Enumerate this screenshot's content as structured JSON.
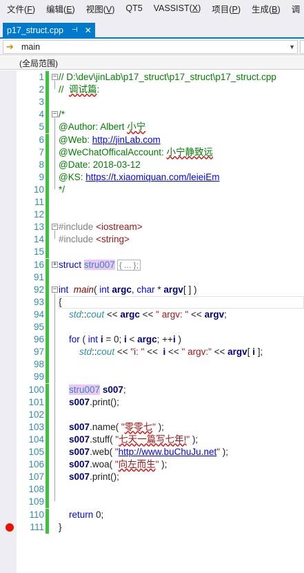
{
  "menu": [
    {
      "label": "文件",
      "key": "F"
    },
    {
      "label": "编辑",
      "key": "E"
    },
    {
      "label": "视图",
      "key": "V"
    },
    {
      "label": "QT5",
      "key": ""
    },
    {
      "label": "VASSIST",
      "key": "X"
    },
    {
      "label": "项目",
      "key": "P"
    },
    {
      "label": "生成",
      "key": "B"
    },
    {
      "label": "调",
      "key": ""
    }
  ],
  "tab": {
    "title": "p17_struct.cpp",
    "pin": "⊣",
    "close": "✕"
  },
  "navbar": {
    "function": "main",
    "scope": "(全局范围)"
  },
  "editor": {
    "lines": [
      {
        "n": "1",
        "html": "<span class=\"c-com\">// D:\\dev\\jinLab\\p17_struct\\p17_struct\\p17_struct.cpp</span>"
      },
      {
        "n": "2",
        "html": "<span class=\"c-com\">//  <span class=\"squig\">调试篇</span>:</span>"
      },
      {
        "n": "3",
        "html": ""
      },
      {
        "n": "4",
        "html": "<span class=\"c-com\">/*</span>"
      },
      {
        "n": "5",
        "html": "<span class=\"c-com\">@Author: Albert <span class=\"squig\">小宁</span></span>"
      },
      {
        "n": "6",
        "html": "<span class=\"c-com\">@Web: <span class=\"link\">http://jinLab.com</span></span>"
      },
      {
        "n": "7",
        "html": "<span class=\"c-com\">@WeChatOfficalAccount: <span class=\"squig\">小宁静致远</span></span>"
      },
      {
        "n": "8",
        "html": "<span class=\"c-com\">@Date: 2018-03-12</span>"
      },
      {
        "n": "9",
        "html": "<span class=\"c-com\">@KS: <span class=\"link\">https://t.xiaomiquan.com/leieiEm</span></span>"
      },
      {
        "n": "10",
        "html": "<span class=\"c-com\">*/</span>"
      },
      {
        "n": "11",
        "html": ""
      },
      {
        "n": "12",
        "html": ""
      },
      {
        "n": "13",
        "html": "<span class=\"c-pp\">#include</span> <span class=\"c-str\">&lt;iostream&gt;</span>"
      },
      {
        "n": "14",
        "html": "<span class=\"c-pp\">#include</span> <span class=\"c-str\">&lt;string&gt;</span>"
      },
      {
        "n": "15",
        "html": ""
      },
      {
        "n": "16",
        "html": "<span class=\"c-kw\">struct</span> <span class=\"c-type hl\">stru007</span><span class=\"collapsed\">{ ... };</span>"
      },
      {
        "n": "91",
        "html": ""
      },
      {
        "n": "92",
        "html": "<span class=\"c-kw\">int</span>  <span class=\"c-fn\">main</span>( <span class=\"c-kw\">int</span> <span class=\"c-var\">argc</span>, <span class=\"c-kw\">char</span> * <span class=\"c-var\">argv</span>[ ] )"
      },
      {
        "n": "93",
        "html": "{"
      },
      {
        "n": "94",
        "html": "    <span class=\"c-ns\">std</span>::<span class=\"c-ns\">cout</span> &lt;&lt; <span class=\"c-var\">argc</span> &lt;&lt; <span class=\"c-str\">\" argv: \"</span> &lt;&lt; <span class=\"c-var\">argv</span>;"
      },
      {
        "n": "95",
        "html": ""
      },
      {
        "n": "96",
        "html": "    <span class=\"c-kw\">for</span> ( <span class=\"c-kw\">int</span> <span class=\"c-var\">i</span> = 0; <span class=\"c-var\">i</span> &lt; <span class=\"c-var\">argc</span>; ++<span class=\"c-var\">i</span> )"
      },
      {
        "n": "97",
        "html": "        <span class=\"c-ns\">std</span>::<span class=\"c-ns\">cout</span> &lt;&lt; <span class=\"c-str\">\"i: \"</span> &lt;&lt;  <span class=\"c-var\">i</span> &lt;&lt; <span class=\"c-str\">\" argv:\"</span> &lt;&lt; <span class=\"c-var\">argv</span>[ <span class=\"c-var\">i</span> ];"
      },
      {
        "n": "98",
        "html": ""
      },
      {
        "n": "99",
        "html": ""
      },
      {
        "n": "100",
        "html": "    <span class=\"c-type hl\">stru007</span> <span class=\"c-var\">s007</span>;"
      },
      {
        "n": "101",
        "html": "    <span class=\"c-var\">s007</span>.print();"
      },
      {
        "n": "102",
        "html": ""
      },
      {
        "n": "103",
        "html": "    <span class=\"c-var\">s007</span>.name( <span class=\"c-str\">\"<span class=\"squig\">零零七</span>\"</span> );"
      },
      {
        "n": "104",
        "html": "    <span class=\"c-var\">s007</span>.stuff( <span class=\"c-str\">\"<span class=\"squig\">七天一篇写七年!</span>\"</span> );"
      },
      {
        "n": "105",
        "html": "    <span class=\"c-var\">s007</span>.web( <span class=\"c-str\">\"<span class=\"link\">http://www.buChuJu.net</span>\"</span> );"
      },
      {
        "n": "106",
        "html": "    <span class=\"c-var\">s007</span>.woa( <span class=\"c-str\">\"<span class=\"squig\">向左而生</span>\"</span> );"
      },
      {
        "n": "107",
        "html": "    <span class=\"c-var\">s007</span>.print();"
      },
      {
        "n": "108",
        "html": ""
      },
      {
        "n": "109",
        "html": ""
      },
      {
        "n": "110",
        "html": "    <span class=\"c-kw\">return</span> 0;"
      },
      {
        "n": "111",
        "html": "}"
      }
    ],
    "breakpoint_line": "111",
    "colors": {
      "line_numbers": "#2b91af",
      "changed_bar": "#3fc03f",
      "breakpoint": "#e51400",
      "tab": "#007acc"
    }
  }
}
